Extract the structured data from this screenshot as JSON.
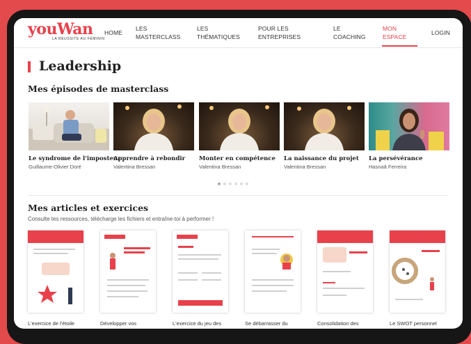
{
  "header": {
    "logo_text": "youWan",
    "logo_tagline": "LA RÉUSSITE AU FÉMININ",
    "nav": [
      {
        "line1": "HOME",
        "line2": ""
      },
      {
        "line1": "LES",
        "line2": "MASTERCLASS"
      },
      {
        "line1": "LES",
        "line2": "THÉMATIQUES"
      },
      {
        "line1": "POUR LES",
        "line2": "ENTREPRISES"
      },
      {
        "line1": "LE",
        "line2": "COACHING"
      },
      {
        "line1": "MON",
        "line2": "ESPACE"
      },
      {
        "line1": "LOGIN",
        "line2": ""
      }
    ],
    "active_nav": "MON ESPACE"
  },
  "page": {
    "title": "Leadership"
  },
  "episodes_section": {
    "title": "Mes épisodes de masterclass",
    "items": [
      {
        "title": "Le syndrome de l'imposteur",
        "author": "Guillaume-Olivier Doré"
      },
      {
        "title": "Apprendre à rebondir",
        "author": "Valentina Bressan"
      },
      {
        "title": "Monter en compétence",
        "author": "Valentina Bressan"
      },
      {
        "title": "La naissance du projet",
        "author": "Valentina Bressan"
      },
      {
        "title": "La persévérance",
        "author": "Hasnaâ Ferreira"
      }
    ],
    "carousel_pages": 6,
    "carousel_active": 1
  },
  "articles_section": {
    "title": "Mes articles et exercices",
    "subtitle": "Consulte tes ressources, télécharge les fichiers et entraîne-toi à performer !",
    "items": [
      {
        "title": "L'exercice de l'étoile"
      },
      {
        "title": "Développer vos"
      },
      {
        "title": "L'exercice du jeu des"
      },
      {
        "title": "Se débarrasser du"
      },
      {
        "title": "Consolidation des"
      },
      {
        "title": "Le SWOT personnel"
      }
    ]
  },
  "colors": {
    "brand_red": "#e8414b",
    "background": "#e24a4c",
    "bezel": "#161616"
  }
}
